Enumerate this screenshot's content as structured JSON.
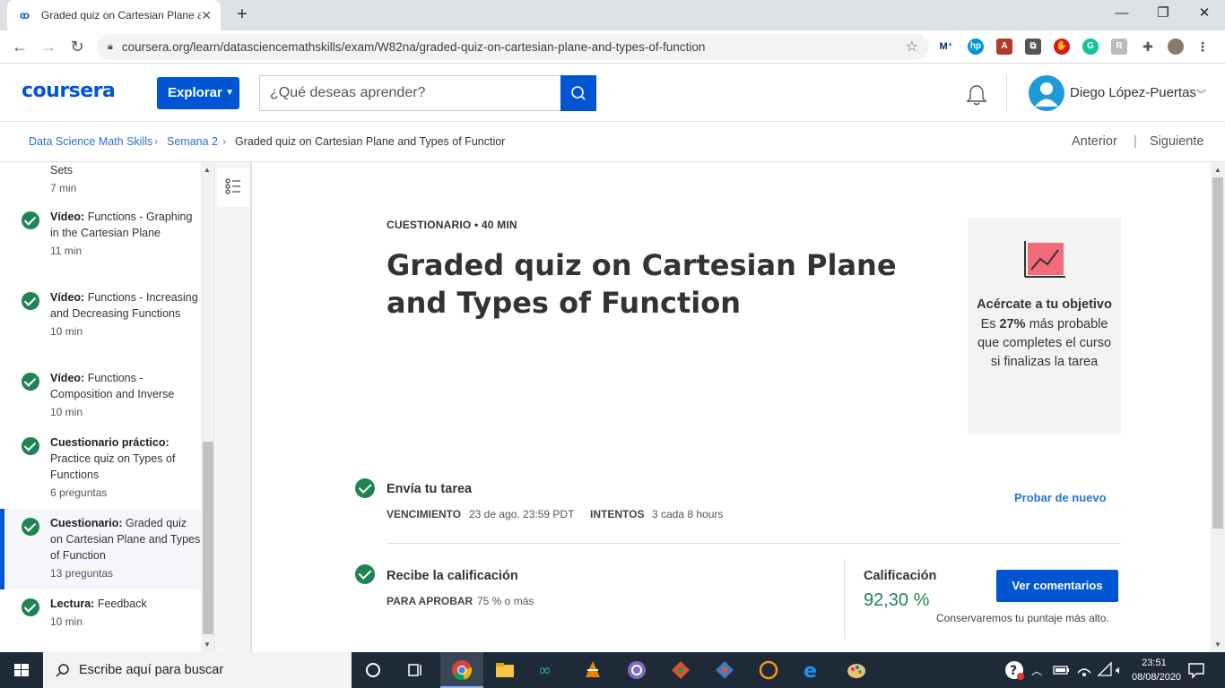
{
  "browser": {
    "tab_title": "Graded quiz on Cartesian Plane and Types of Function | Coursera",
    "url": "coursera.org/learn/datasciencemathskills/exam/W82na/graded-quiz-on-cartesian-plane-and-types-of-function"
  },
  "header": {
    "logo": "coursera",
    "explore_label": "Explorar",
    "search_placeholder": "¿Qué deseas aprender?",
    "username": "Diego López-Puertas"
  },
  "breadcrumb": {
    "items": [
      "Data Science Math Skills",
      "Semana 2",
      "Graded quiz on Cartesian Plane and Types of Functior"
    ],
    "previous": "Anterior",
    "next": "Siguiente"
  },
  "sidebar": {
    "items": [
      {
        "prefix": "",
        "title": "Sets",
        "meta": "7 min"
      },
      {
        "prefix": "Vídeo:",
        "title": "Functions - Graphing in the Cartesian Plane",
        "meta": "11 min"
      },
      {
        "prefix": "Vídeo:",
        "title": "Functions - Increasing and Decreasing Functions",
        "meta": "10 min"
      },
      {
        "prefix": "Vídeo:",
        "title": "Functions - Composition and Inverse",
        "meta": "10 min"
      },
      {
        "prefix": "Cuestionario práctico:",
        "title": "Practice quiz on Types of Functions",
        "meta": "6 preguntas"
      },
      {
        "prefix": "Cuestionario:",
        "title": "Graded quiz on Cartesian Plane and Types of Function",
        "meta": "13 preguntas"
      },
      {
        "prefix": "Lectura:",
        "title": "Feedback",
        "meta": "10 min"
      }
    ]
  },
  "quiz": {
    "kicker": "CUESTIONARIO • 40 MIN",
    "title": "Graded quiz on Cartesian Plane and Types of Function",
    "goal": {
      "heading": "Acércate a tu objetivo",
      "body_pre": "Es ",
      "body_pct": "27%",
      "body_post": " más probable que completes el curso si finalizas la tarea"
    },
    "submit": {
      "title": "Envía tu tarea",
      "due_label": "VENCIMIENTO",
      "due_value": "23 de ago. 23:59 PDT",
      "attempts_label": "INTENTOS",
      "attempts_value": "3 cada 8 hours",
      "retry": "Probar de nuevo"
    },
    "grade": {
      "title": "Recibe la calificación",
      "pass_label": "PARA APROBAR",
      "pass_value": "75 % o más",
      "grade_label": "Calificación",
      "grade_value": "92,30 %",
      "feedback_button": "Ver comentarios",
      "note": "Conservaremos tu puntaje más alto."
    }
  },
  "taskbar": {
    "search_placeholder": "Escribe aquí para buscar",
    "time": "23:51",
    "date": "08/08/2020"
  }
}
